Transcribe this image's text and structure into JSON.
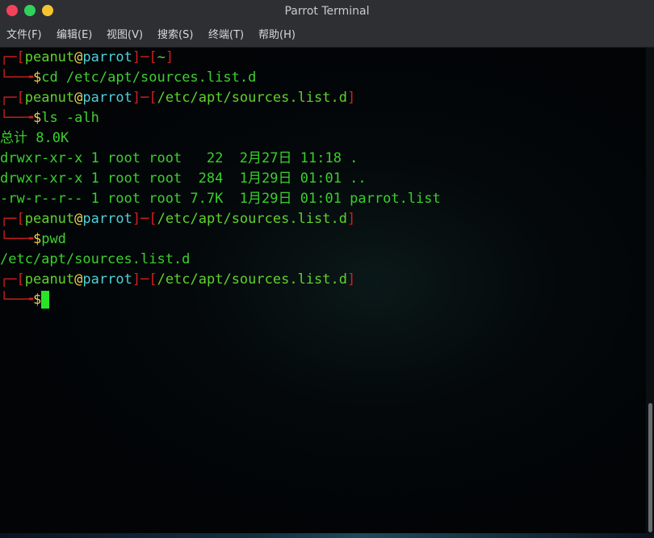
{
  "window": {
    "title": "Parrot Terminal"
  },
  "menu": [
    "文件(F)",
    "编辑(E)",
    "视图(V)",
    "搜索(S)",
    "终端(T)",
    "帮助(H)"
  ],
  "prompt": {
    "corner_top": "┌─",
    "corner_bottom": "└──╼",
    "user": "peanut",
    "at": "@",
    "host": "parrot",
    "sep": "─",
    "lbracket": "[",
    "rbracket": "]",
    "dollar": "$"
  },
  "blocks": [
    {
      "dir": "~",
      "command": "cd /etc/apt/sources.list.d"
    },
    {
      "dir": "/etc/apt/sources.list.d",
      "command": "ls -alh"
    },
    {
      "dir": "/etc/apt/sources.list.d",
      "command": "pwd"
    },
    {
      "dir": "/etc/apt/sources.list.d",
      "command": ""
    }
  ],
  "output": {
    "ls_total": "总计 8.0K",
    "ls_rows": [
      "drwxr-xr-x 1 root root   22  2月27日 11:18 .",
      "drwxr-xr-x 1 root root  284  1月29日 01:01 ..",
      "-rw-r--r-- 1 root root 7.7K  1月29日 01:01 parrot.list"
    ],
    "pwd": "/etc/apt/sources.list.d"
  }
}
